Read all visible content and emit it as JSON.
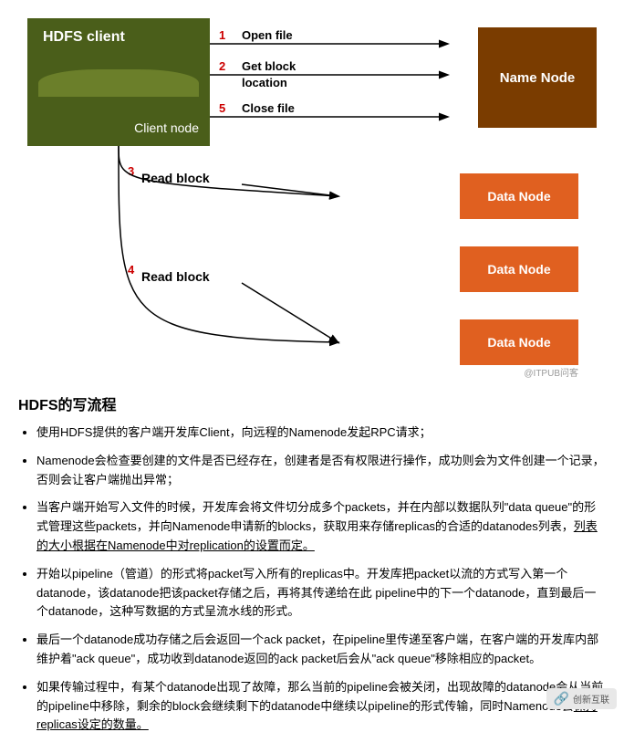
{
  "diagram": {
    "hdfs_client_label": "HDFS client",
    "client_node_label": "Client node",
    "name_node_label": "Name Node",
    "data_node_label": "Data Node",
    "arrows": [
      {
        "step": "1",
        "label": "Open file",
        "type": "right-to-namenode"
      },
      {
        "step": "2",
        "label": "Get block\nlocation",
        "type": "right-to-namenode"
      },
      {
        "step": "5",
        "label": "Close file",
        "type": "right-to-namenode"
      },
      {
        "step": "3",
        "label": "Read block",
        "type": "down-to-datanode1"
      },
      {
        "step": "4",
        "label": "Read block",
        "type": "down-to-datanode3"
      }
    ],
    "watermark": "@ITPUB问客"
  },
  "text_section": {
    "title": "HDFS的写流程",
    "bullets": [
      "使用HDFS提供的客户端开发库Client，向远程的Namenode发起RPC请求；",
      "Namenode会检查要创建的文件是否已经存在，创建者是否有权限进行操作，成功则会为文件创建一个记录，否则会让客户端抛出异常；",
      "当客户端开始写入文件的时候，开发库会将文件切分成多个packets，并在内部以数据队列\"data queue\"的形式管理这些packets，并向Namenode申请新的blocks，获取用来存储replicas的合适的datanodes列表，列表的大小根据在Namenode中对replication的设置而定。",
      "开始以pipeline（管道）的形式将packet写入所有的replicas中。开发库把packet以流的方式写入第一个datanode，该datanode把该packet存储之后，再将其传递给在此 pipeline中的下一个datanode，直到最后一个datanode，这种写数据的方式呈流水线的形式。",
      "最后一个datanode成功存储之后会返回一个ack packet，在pipeline里传递至客户端，在客户端的开发库内部维护着\"ack queue\"，成功收到datanode返回的ack packet后会从\"ack queue\"移除相应的packet。",
      "如果传输过程中，有某个datanode出现了故障，那么当前的pipeline会被关闭，出现故障的datanode会从当前的pipeline中移除，剩余的block会继续剩下的datanode中继续以pipeline的形式传输，同时Namenode会保持 replicas设定的数量。"
    ]
  },
  "logo": {
    "text": "创新互联"
  }
}
